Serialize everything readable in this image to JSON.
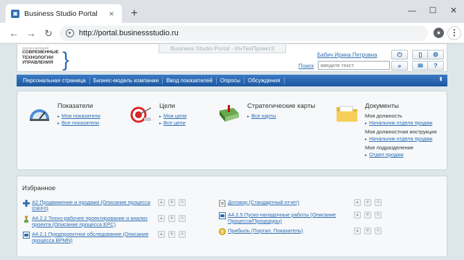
{
  "browser": {
    "tab_title": "Business Studio Portal",
    "tab_close": "×",
    "new_tab": "+",
    "url": "http://portal.businessstudio.ru",
    "window_minimize": "—",
    "window_maximize": "☐",
    "window_close": "✕"
  },
  "header": {
    "logo_small": "группа компаний",
    "logo_lines": [
      "СОВРЕМЕННЫЕ",
      "ТЕХНОЛОГИИ",
      "УПРАВЛЕНИЯ"
    ],
    "site_title": "Business Studio Portal - ИнТехПроект3",
    "user_name": "Бабич Ирина Петровна",
    "search_label": "Поиск",
    "search_placeholder": "введите текст"
  },
  "nav": {
    "items": [
      "Персональная страница",
      "Бизнес-модель компании",
      "Ввод показателей",
      "Опросы",
      "Обсуждения"
    ]
  },
  "quick": {
    "indicators": {
      "title": "Показатели",
      "links": [
        "Мои показатели",
        "Все показатели"
      ]
    },
    "goals": {
      "title": "Цели",
      "links": [
        "Мои цели",
        "Все цели"
      ]
    },
    "maps": {
      "title": "Стратегические карты",
      "links": [
        "Все карты"
      ]
    },
    "docs": {
      "title": "Документы",
      "position_label": "Моя должность",
      "position_link": "Начальник отдела продаж",
      "instruction_label": "Моя должностная инструкция",
      "instruction_link": "Начальник отдела продаж",
      "department_label": "Мое подразделение",
      "department_link": "Отдел продаж"
    }
  },
  "favorites": {
    "title": "Избранное",
    "left": [
      "А2 Продвижение и продажи (Описание процесса IDEF0)",
      "А4.2.2 Техно-рабочее проектирование и анализ проекта (Описание процесса EPC)",
      "А4.2.1 Предпроектное обследование (Описание процесса BPMN)"
    ],
    "right": [
      "Договор (Стандартный отчет)",
      "А4.2.5 Пуско-наладочные работы (Описание Процесса/Процедуры)",
      "Прибыль (Портал. Показатель)"
    ]
  },
  "colors": {
    "accent": "#2b6cb3",
    "navbar": "#1d56a0",
    "page_bg": "#dde6ea"
  }
}
